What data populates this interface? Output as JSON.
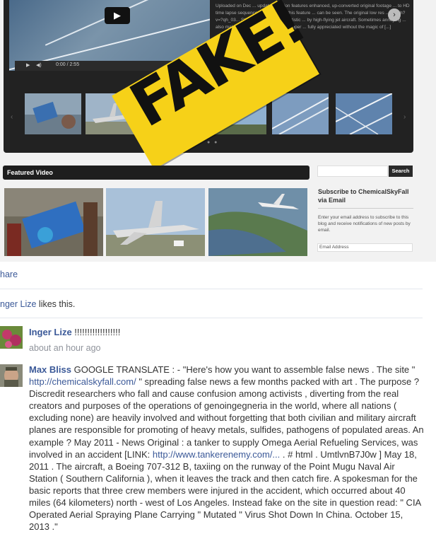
{
  "video": {
    "play_icon": "play-icon",
    "time": "0:00 / 2:55",
    "description": "Uploaded on Dec ... updated version features enhanced, up-converted original footage ... to HD time lapse sequences, showcasing this feature ... can be seen. The original low res ... watch?v=?qh_03... Stitching the Sky is an artistic ... by high-flying jet aircraft. Sometimes annoying ... also makes visible the motion of the upper ... fully appreciated without the magic of [...]"
  },
  "overlay": {
    "text": "FAKE!"
  },
  "featured": {
    "title": "Featured Video"
  },
  "search": {
    "button": "Search"
  },
  "subscribe": {
    "title": "Subscribe to ChemicalSkyFall via Email",
    "text": "Enter your email address to subscribe to this blog and receive notifications of new posts by email.",
    "email_placeholder": "Email Address"
  },
  "feed": {
    "share": "hare",
    "likes_name": "nger Lize",
    "likes_text": " likes this."
  },
  "comments": [
    {
      "name": "Inger Lize",
      "text": " !!!!!!!!!!!!!!!!!!",
      "time": "about an hour ago"
    },
    {
      "name": "Max Bliss",
      "text_1": " GOOGLE TRANSLATE : - \"Here's how you want to assemble false news . The site \" ",
      "link_1": "http://chemicalskyfall.com/",
      "text_2": " \" spreading false news a few months packed with art . The purpose ? Discredit researchers who fall and cause confusion among activists , diverting from the real creators and purposes of the operations of genoingegneria in the world, where all nations ( excluding none) are heavily involved and without forgetting that both civilian and military aircraft planes are responsible for promoting of heavy metals, sulfides, pathogens of populated areas. An example ? May 2011 - News Original : a tanker to supply Omega Aerial Refueling Services, was involved in an accident [LINK: ",
      "link_2": "http://www.tankerenemy.com/...",
      "text_3": " . # html . UmtlvnB7J0w ] May 18, 2011 . The aircraft, a Boeing 707-312 B, taxiing on the runway of the Point Mugu Naval Air Station ( Southern California ), when it leaves the track and then catch fire. A spokesman for the basic reports that three crew members were injured in the accident, which occurred about 40 miles (64 kilometers) north - west of Los Angeles. Instead fake on the site in question read: \" CIA Operated Aerial Spraying Plane Carrying \" Mutated \" Virus Shot Down In China. October 15, 2013 .\""
    }
  ]
}
